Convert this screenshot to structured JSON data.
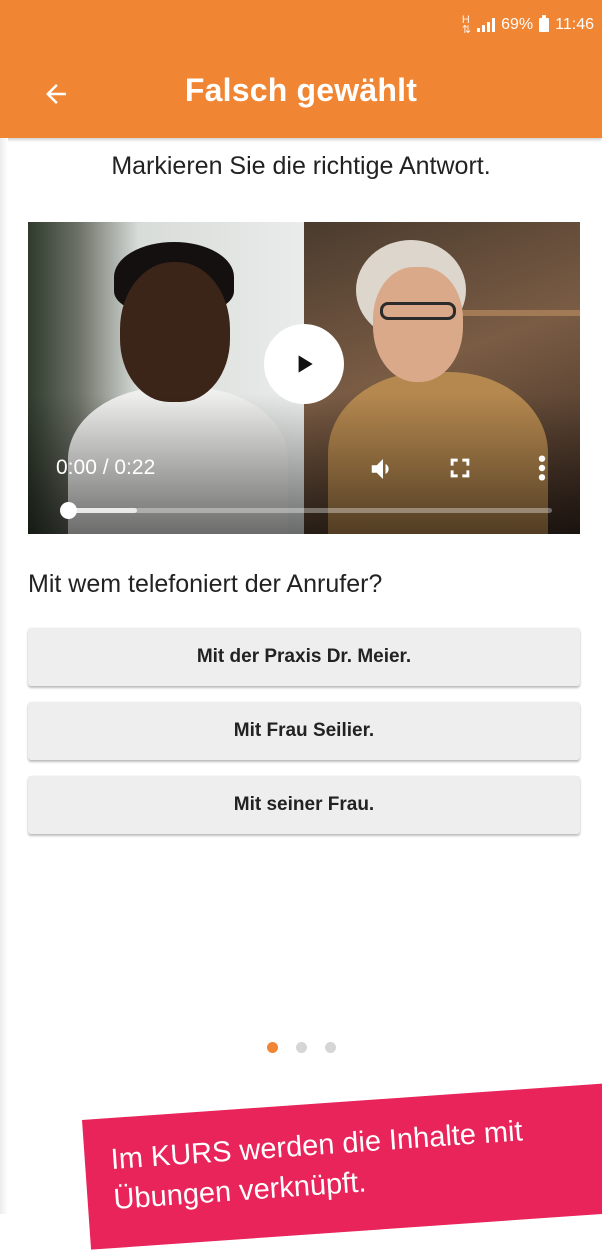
{
  "status_bar": {
    "battery_percent": "69%",
    "time": "11:46",
    "icons": [
      "network-type-icon",
      "signal-icon",
      "battery-icon"
    ]
  },
  "app_bar": {
    "title": "Falsch gewählt",
    "back_icon": "arrow-left-icon",
    "color": "#f08533"
  },
  "instruction": "Markieren Sie die richtige Antwort.",
  "video": {
    "time": "0:00 / 0:22",
    "progress_fraction": 0.0,
    "buffered_fraction": 0.15,
    "controls": [
      "play-icon",
      "volume-icon",
      "fullscreen-icon",
      "more-vert-icon"
    ]
  },
  "question": "Mit wem telefoniert der Anrufer?",
  "answers": [
    {
      "label": "Mit der Praxis Dr. Meier."
    },
    {
      "label": "Mit Frau Seilier."
    },
    {
      "label": "Mit seiner Frau."
    }
  ],
  "pagination": {
    "total": 3,
    "active_index": 0
  },
  "banner": {
    "line1": "Im KURS werden die Inhalte mit",
    "line2": "Übungen verknüpft.",
    "color": "#e8245a"
  }
}
